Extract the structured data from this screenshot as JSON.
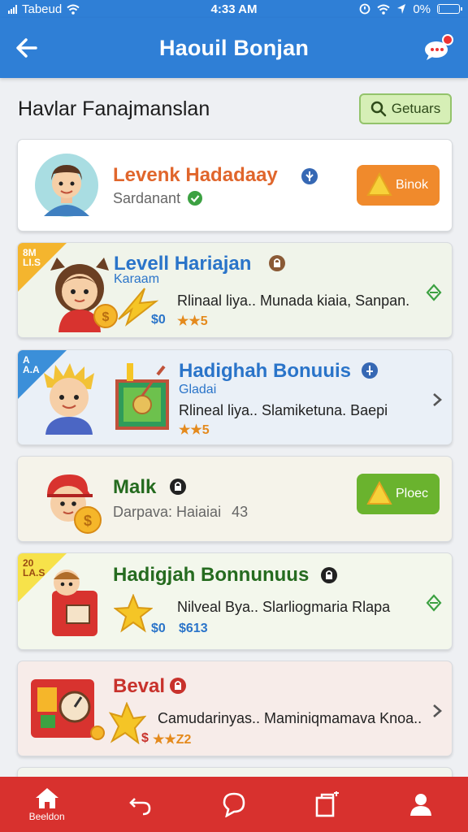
{
  "status": {
    "carrier": "Tabeud",
    "time": "4:33 AM",
    "battery": "0%",
    "battery_level": 0.04
  },
  "appbar": {
    "title": "Haouil Bonjan",
    "back_icon": "arrow-left-icon",
    "chat_icon": "chat-bubble-icon"
  },
  "section": {
    "title": "Havlar Fanajmanslan",
    "search_label": "Getuars"
  },
  "cards": [
    {
      "name": "Levenk Hadadaay",
      "subtitle": "Sardanant",
      "action": "Binok",
      "name_color": "#e0662c",
      "accent": "#f08a2c"
    },
    {
      "ribbon": "8M\nLI.S",
      "name": "Levell Hariajan",
      "subtitle": "Karaam",
      "description": "Rlinaal liya.. Munada kiaia, Sanpan.",
      "stat_money": "$0",
      "stat_stars": "5",
      "name_color": "#2a74c9"
    },
    {
      "ribbon": "A\nA.A",
      "name": "Hadighah Bonuuis",
      "subtitle": "Gladai",
      "description": "Rlineal liya.. Slamiketuna. Baepi",
      "stat_stars": "5",
      "name_color": "#2a74c9"
    },
    {
      "name": "Malk",
      "subtitle": "Darpava: Haiaiai",
      "subtitle_value": "43",
      "action": "Ploec",
      "name_color": "#256b1f",
      "accent": "#6ab32e"
    },
    {
      "ribbon": "20\nLA.S",
      "name": "Hadigjah Bonnunuus",
      "description": "Nilveal Bya.. Slarliogmaria Rlapa",
      "stat_money": "$0",
      "stat_value": "$613",
      "name_color": "#256b1f"
    },
    {
      "name": "Beval",
      "description": "Camudarinyas.. Maminiqmamava Knoa..",
      "stat_money": "$",
      "stat_stars": "Z2",
      "name_color": "#c8322c"
    }
  ],
  "nav": [
    {
      "label": "Beeldon",
      "icon": "home-icon"
    },
    {
      "label": "",
      "icon": "undo-icon"
    },
    {
      "label": "",
      "icon": "chat-icon"
    },
    {
      "label": "",
      "icon": "clipboard-icon"
    },
    {
      "label": "",
      "icon": "user-icon"
    }
  ]
}
